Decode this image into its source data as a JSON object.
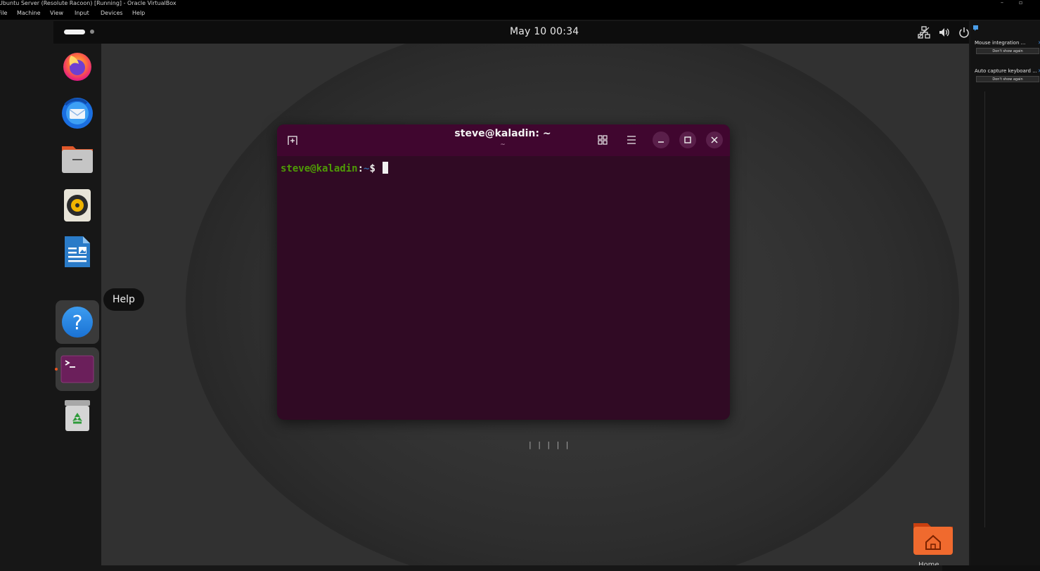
{
  "host": {
    "window_title": "Ubuntu Server (Resolute Racoon) [Running] - Oracle VirtualBox",
    "menu": [
      "File",
      "Machine",
      "View",
      "Input",
      "Devices",
      "Help"
    ],
    "notifications": [
      {
        "message": "Mouse integration ...",
        "button": "Don't show again"
      },
      {
        "message": "Auto capture keyboard ...",
        "button": "Don't show again"
      }
    ]
  },
  "guest": {
    "clock": "May 10  00:34",
    "dock": [
      {
        "name": "firefox",
        "label": "Firefox"
      },
      {
        "name": "thunderbird",
        "label": "Thunderbird"
      },
      {
        "name": "files",
        "label": "Files"
      },
      {
        "name": "rhythmbox",
        "label": "Rhythmbox"
      },
      {
        "name": "writer",
        "label": "LibreOffice Writer"
      },
      {
        "name": "help",
        "label": "Help",
        "hovered": true
      },
      {
        "name": "terminal",
        "label": "Terminal",
        "running": true
      },
      {
        "name": "trash",
        "label": "Trash"
      }
    ],
    "tooltip": "Help",
    "terminal": {
      "title": "steve@kaladin: ~",
      "subtitle": "~",
      "prompt_user": "steve@kaladin",
      "prompt_sep": ":",
      "prompt_path": "~",
      "prompt_sign": "$ "
    },
    "desktop_icons": [
      {
        "name": "home",
        "label": "Home"
      }
    ]
  },
  "colors": {
    "terminal_bg": "#300a24",
    "terminal_header": "#40062f",
    "prompt_user": "#4e9a06",
    "prompt_path": "#3465a4",
    "ubuntu_orange": "#e95420"
  }
}
